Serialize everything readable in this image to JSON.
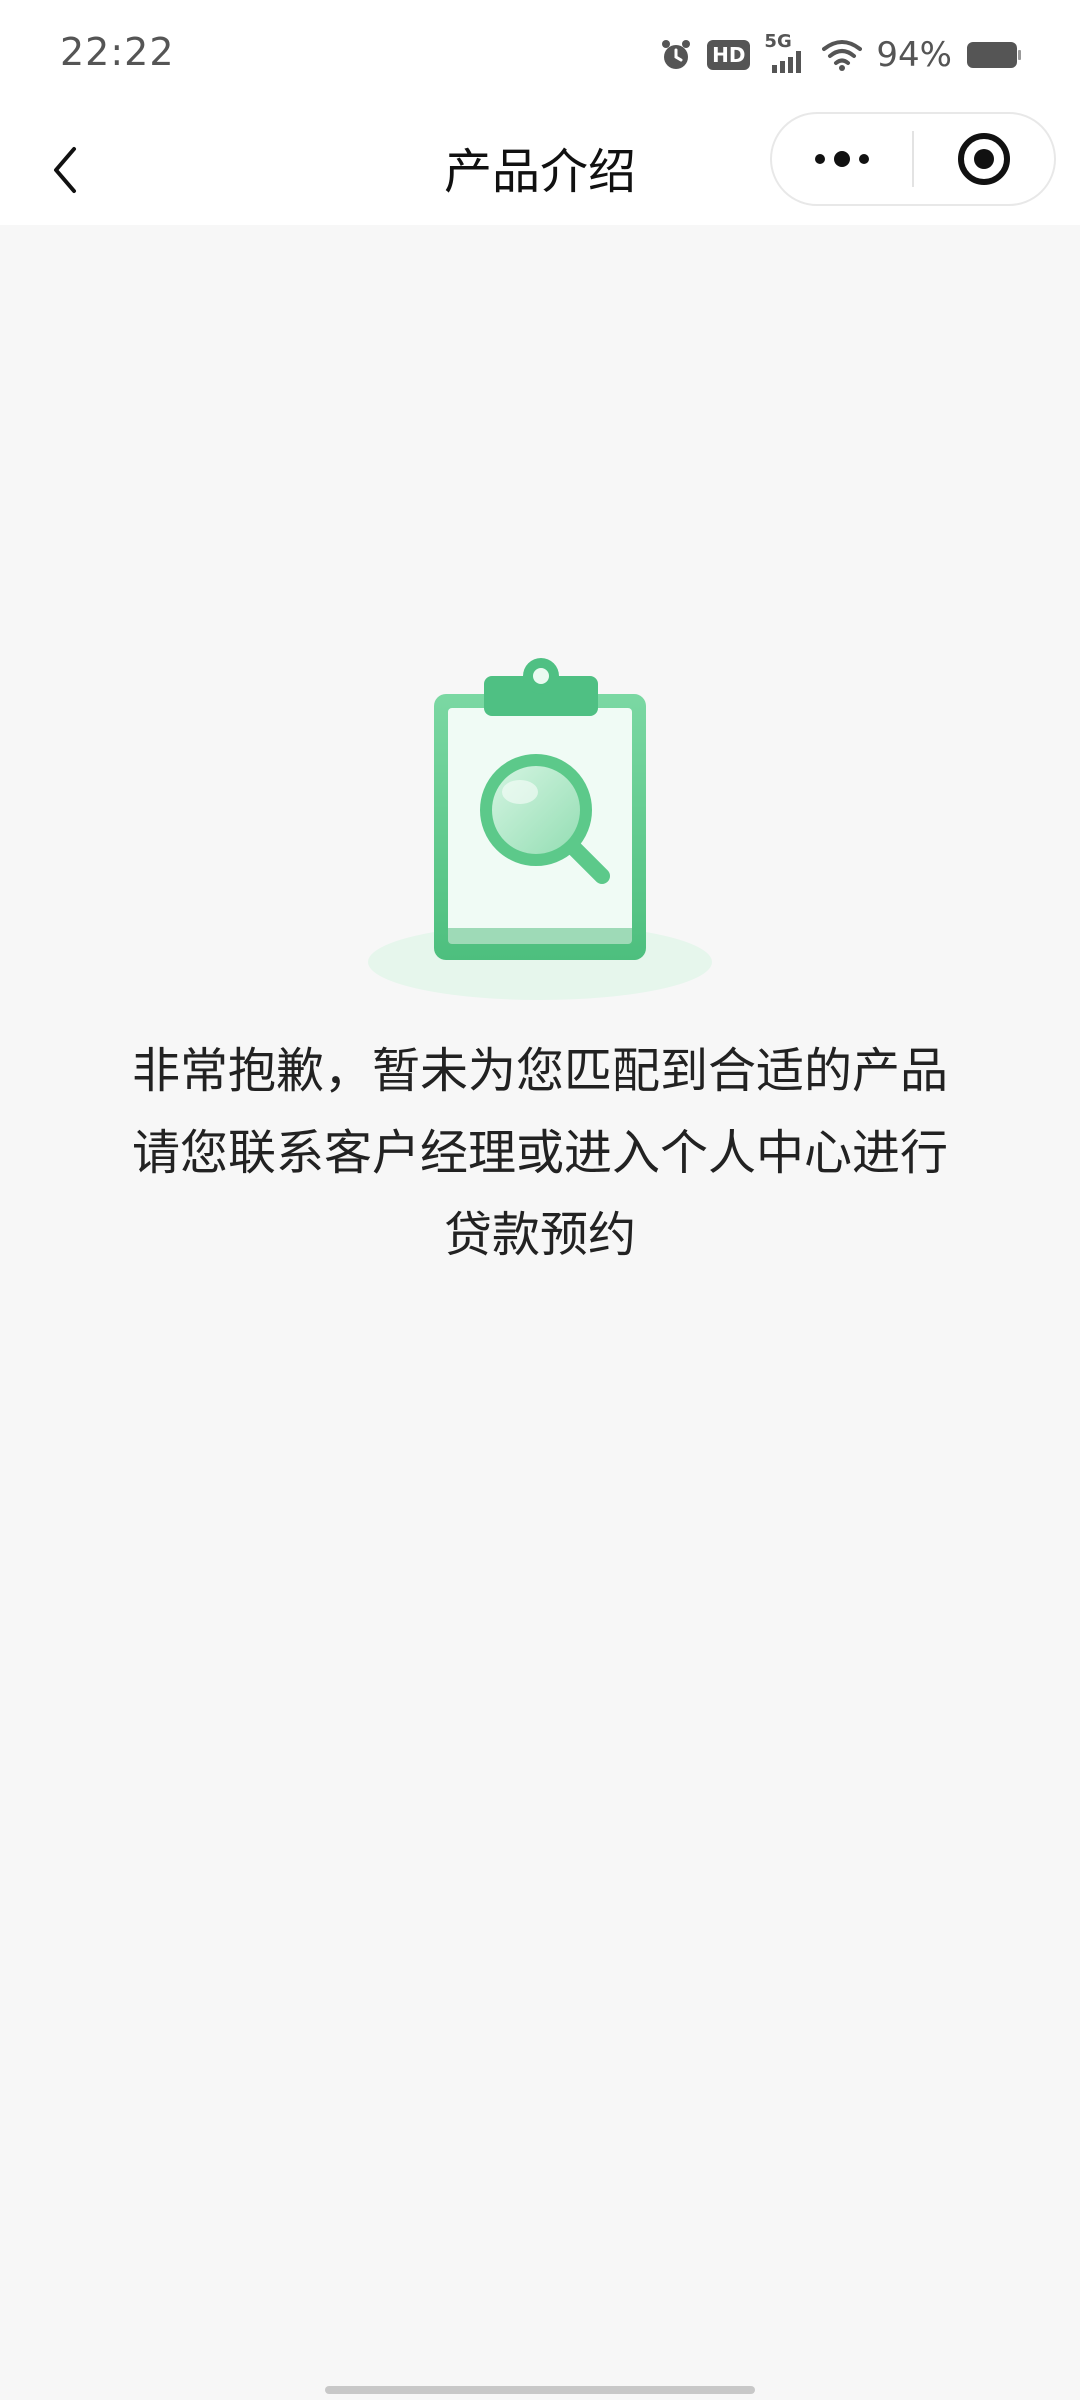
{
  "status_bar": {
    "time": "22:22",
    "battery_percent": "94%",
    "network_label": "5G",
    "hd_label": "HD",
    "icons": [
      "alarm-icon",
      "hd-icon",
      "signal-5g-icon",
      "wifi-icon",
      "battery-icon"
    ],
    "battery_level": 0.94
  },
  "nav": {
    "title": "产品介绍",
    "back_icon": "chevron-left-icon",
    "more_icon": "more-dots-icon",
    "close_icon": "record-target-icon"
  },
  "empty_state": {
    "illustration_icon": "clipboard-search-icon",
    "message_lines": [
      "非常抱歉，暂未为您匹配到合适的产品",
      "请您联系客户经理或进入个人中心进行",
      "贷款预约"
    ]
  },
  "colors": {
    "accent_green": "#5cc98a",
    "background": "#f7f7f7"
  }
}
